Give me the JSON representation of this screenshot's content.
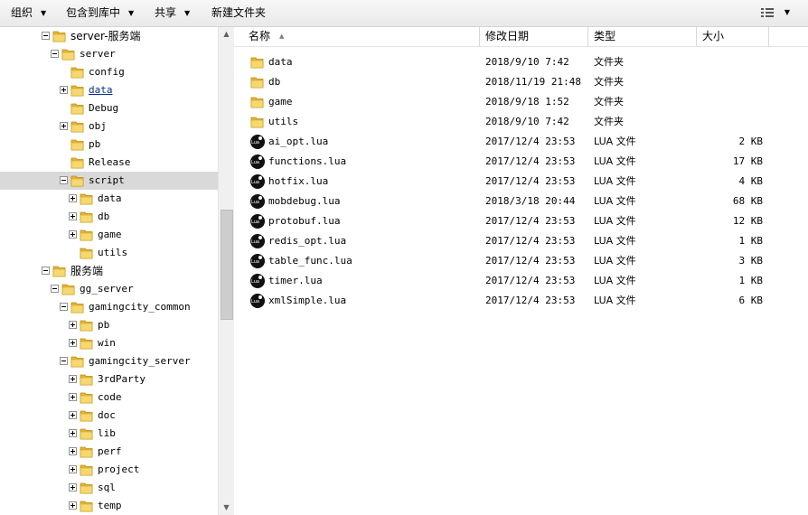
{
  "toolbar": {
    "organize": "组织",
    "include_in_library": "包含到库中",
    "share": "共享",
    "new_folder": "新建文件夹"
  },
  "tree": [
    {
      "label": "server-服务端",
      "indent": 0,
      "expander": "minus",
      "selected": false,
      "link": false
    },
    {
      "label": "server",
      "indent": 1,
      "expander": "minus",
      "selected": false,
      "link": false
    },
    {
      "label": "config",
      "indent": 2,
      "expander": "",
      "selected": false,
      "link": false
    },
    {
      "label": "data",
      "indent": 2,
      "expander": "plus",
      "selected": false,
      "link": true
    },
    {
      "label": "Debug",
      "indent": 2,
      "expander": "",
      "selected": false,
      "link": false
    },
    {
      "label": "obj",
      "indent": 2,
      "expander": "plus",
      "selected": false,
      "link": false
    },
    {
      "label": "pb",
      "indent": 2,
      "expander": "",
      "selected": false,
      "link": false
    },
    {
      "label": "Release",
      "indent": 2,
      "expander": "",
      "selected": false,
      "link": false
    },
    {
      "label": "script",
      "indent": 2,
      "expander": "minus",
      "selected": true,
      "link": false
    },
    {
      "label": "data",
      "indent": 3,
      "expander": "plus",
      "selected": false,
      "link": false
    },
    {
      "label": "db",
      "indent": 3,
      "expander": "plus",
      "selected": false,
      "link": false
    },
    {
      "label": "game",
      "indent": 3,
      "expander": "plus",
      "selected": false,
      "link": false
    },
    {
      "label": "utils",
      "indent": 3,
      "expander": "",
      "selected": false,
      "link": false
    },
    {
      "label": "服务端",
      "indent": 0,
      "expander": "minus",
      "selected": false,
      "link": false
    },
    {
      "label": "gg_server",
      "indent": 1,
      "expander": "minus",
      "selected": false,
      "link": false
    },
    {
      "label": "gamingcity_common",
      "indent": 2,
      "expander": "minus",
      "selected": false,
      "link": false
    },
    {
      "label": "pb",
      "indent": 3,
      "expander": "plus",
      "selected": false,
      "link": false
    },
    {
      "label": "win",
      "indent": 3,
      "expander": "plus",
      "selected": false,
      "link": false
    },
    {
      "label": "gamingcity_server",
      "indent": 2,
      "expander": "minus",
      "selected": false,
      "link": false
    },
    {
      "label": "3rdParty",
      "indent": 3,
      "expander": "plus",
      "selected": false,
      "link": false
    },
    {
      "label": "code",
      "indent": 3,
      "expander": "plus",
      "selected": false,
      "link": false
    },
    {
      "label": "doc",
      "indent": 3,
      "expander": "plus",
      "selected": false,
      "link": false
    },
    {
      "label": "lib",
      "indent": 3,
      "expander": "plus",
      "selected": false,
      "link": false
    },
    {
      "label": "perf",
      "indent": 3,
      "expander": "plus",
      "selected": false,
      "link": false
    },
    {
      "label": "project",
      "indent": 3,
      "expander": "plus",
      "selected": false,
      "link": false
    },
    {
      "label": "sql",
      "indent": 3,
      "expander": "plus",
      "selected": false,
      "link": false
    },
    {
      "label": "temp",
      "indent": 3,
      "expander": "plus",
      "selected": false,
      "link": false
    }
  ],
  "columns": {
    "name": "名称",
    "modified": "修改日期",
    "type": "类型",
    "size": "大小"
  },
  "files": [
    {
      "name": "data",
      "date": "2018/9/10 7:42",
      "type": "文件夹",
      "size": "",
      "icon": "folder-icon"
    },
    {
      "name": "db",
      "date": "2018/11/19 21:48",
      "type": "文件夹",
      "size": "",
      "icon": "folder-icon"
    },
    {
      "name": "game",
      "date": "2018/9/18 1:52",
      "type": "文件夹",
      "size": "",
      "icon": "folder-icon"
    },
    {
      "name": "utils",
      "date": "2018/9/10 7:42",
      "type": "文件夹",
      "size": "",
      "icon": "folder-icon"
    },
    {
      "name": "ai_opt.lua",
      "date": "2017/12/4 23:53",
      "type": "LUA 文件",
      "size": "2 KB",
      "icon": "lua-file-icon"
    },
    {
      "name": "functions.lua",
      "date": "2017/12/4 23:53",
      "type": "LUA 文件",
      "size": "17 KB",
      "icon": "lua-file-icon"
    },
    {
      "name": "hotfix.lua",
      "date": "2017/12/4 23:53",
      "type": "LUA 文件",
      "size": "4 KB",
      "icon": "lua-file-icon"
    },
    {
      "name": "mobdebug.lua",
      "date": "2018/3/18 20:44",
      "type": "LUA 文件",
      "size": "68 KB",
      "icon": "lua-file-icon"
    },
    {
      "name": "protobuf.lua",
      "date": "2017/12/4 23:53",
      "type": "LUA 文件",
      "size": "12 KB",
      "icon": "lua-file-icon"
    },
    {
      "name": "redis_opt.lua",
      "date": "2017/12/4 23:53",
      "type": "LUA 文件",
      "size": "1 KB",
      "icon": "lua-file-icon"
    },
    {
      "name": "table_func.lua",
      "date": "2017/12/4 23:53",
      "type": "LUA 文件",
      "size": "3 KB",
      "icon": "lua-file-icon"
    },
    {
      "name": "timer.lua",
      "date": "2017/12/4 23:53",
      "type": "LUA 文件",
      "size": "1 KB",
      "icon": "lua-file-icon"
    },
    {
      "name": "xmlSimple.lua",
      "date": "2017/12/4 23:53",
      "type": "LUA 文件",
      "size": "6 KB",
      "icon": "lua-file-icon"
    }
  ],
  "colors": {
    "selected_row": "#d9d9d9",
    "folder_yellow": "#f3c94f",
    "link_blue": "#0a2f8a"
  }
}
